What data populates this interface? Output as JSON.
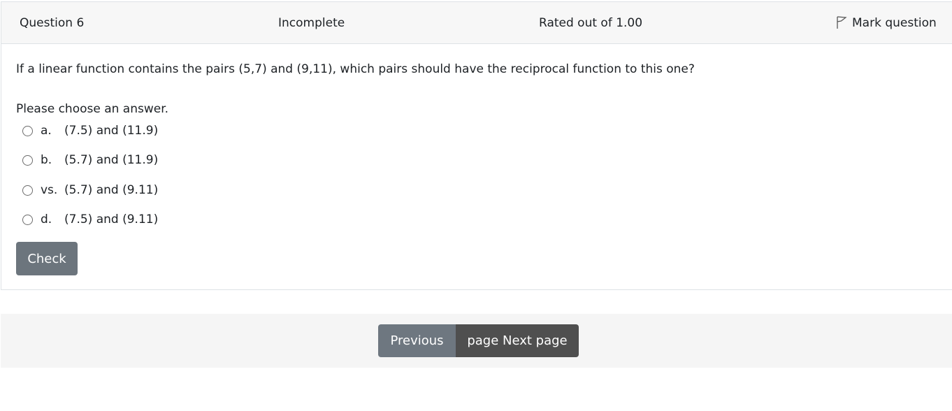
{
  "question": {
    "number_label": "Question 6",
    "state": "Incomplete",
    "grade": "Rated out of 1.00",
    "flag_label": "Mark question",
    "text": "If a linear function contains the pairs (5,7) and (9,11), which pairs should have the reciprocal function to this one?",
    "prompt": "Please choose an answer.",
    "answers": [
      {
        "letter": "a.",
        "text": "(7.5) and (11.9)"
      },
      {
        "letter": "b.",
        "text": "(5.7) and (11.9)"
      },
      {
        "letter": "vs.",
        "text": "(5.7) and (9.11)"
      },
      {
        "letter": "d.",
        "text": "(7.5) and (9.11)"
      }
    ],
    "check_label": "Check"
  },
  "navigation": {
    "previous_label": "Previous",
    "next_label": "page Next page"
  },
  "colors": {
    "check_button": "#6c757d",
    "previous_button": "#6e7780",
    "next_button": "#4f4f4f",
    "header_background": "#f7f7f7"
  }
}
